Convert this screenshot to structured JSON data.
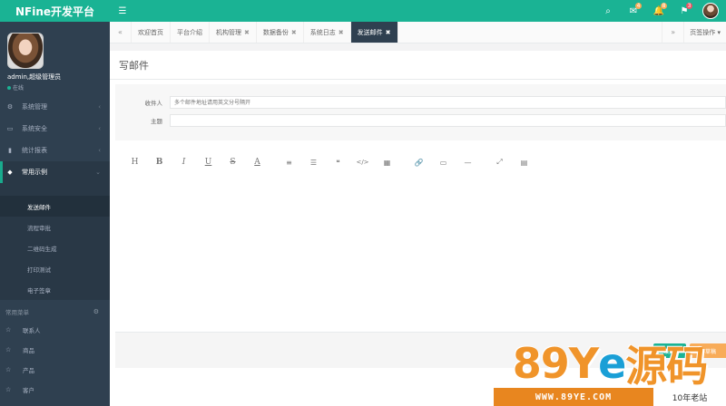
{
  "app": {
    "title": "NFine开发平台"
  },
  "header": {
    "icons": [
      {
        "name": "search-icon",
        "glyph": "🔍",
        "badge": ""
      },
      {
        "name": "envelope-icon",
        "glyph": "✉",
        "badge": "4"
      },
      {
        "name": "bell-icon",
        "glyph": "🔔",
        "badge": "8"
      },
      {
        "name": "flag-icon",
        "glyph": "⚑",
        "badge": "3"
      }
    ]
  },
  "user": {
    "name": "admin,超级管理员",
    "status": "在线"
  },
  "sidebar": {
    "items": [
      {
        "label": "系统管理",
        "icon": "gear-icon"
      },
      {
        "label": "系统安全",
        "icon": "monitor-icon"
      },
      {
        "label": "统计报表",
        "icon": "bar-chart-icon"
      },
      {
        "label": "常用示例",
        "icon": "tag-icon"
      }
    ],
    "sub_items": [
      "发送邮件",
      "流程审批",
      "二维码生成",
      "打印测试",
      "电子签章"
    ],
    "section_title": "常用菜单",
    "favorites": [
      "联系人",
      "商品",
      "产品",
      "客户"
    ]
  },
  "tabs": {
    "prev": "«",
    "next": "»",
    "items": [
      {
        "label": "欢迎首页",
        "closable": false
      },
      {
        "label": "平台介绍",
        "closable": false
      },
      {
        "label": "机构管理",
        "closable": true
      },
      {
        "label": "数据备份",
        "closable": true
      },
      {
        "label": "系统日志",
        "closable": true
      },
      {
        "label": "发送邮件",
        "closable": true,
        "active": true
      }
    ],
    "operations": "页签操作 ▾"
  },
  "page": {
    "title": "写邮件",
    "to_label": "收件人",
    "to_placeholder": "多个邮件地址请用英文分号隔开",
    "subject_label": "主题",
    "subject_value": ""
  },
  "toolbar": [
    "H",
    "B",
    "I",
    "U",
    "S",
    "A",
    "|",
    "≡",
    "☰",
    "❝",
    "</>",
    "▦",
    "|",
    "🔗",
    "▭",
    "—",
    "|",
    "⤢",
    "▤"
  ],
  "footer": {
    "send": "发送",
    "draft": "存草稿"
  },
  "watermark": {
    "brand_left": "89Y",
    "brand_e": "e",
    "brand_right": "源码",
    "url": "WWW.89YE.COM",
    "tag": "10年老站"
  },
  "colors": {
    "accent": "#1ab394",
    "sidebar": "#2f4050",
    "warning": "#f8ac59"
  }
}
